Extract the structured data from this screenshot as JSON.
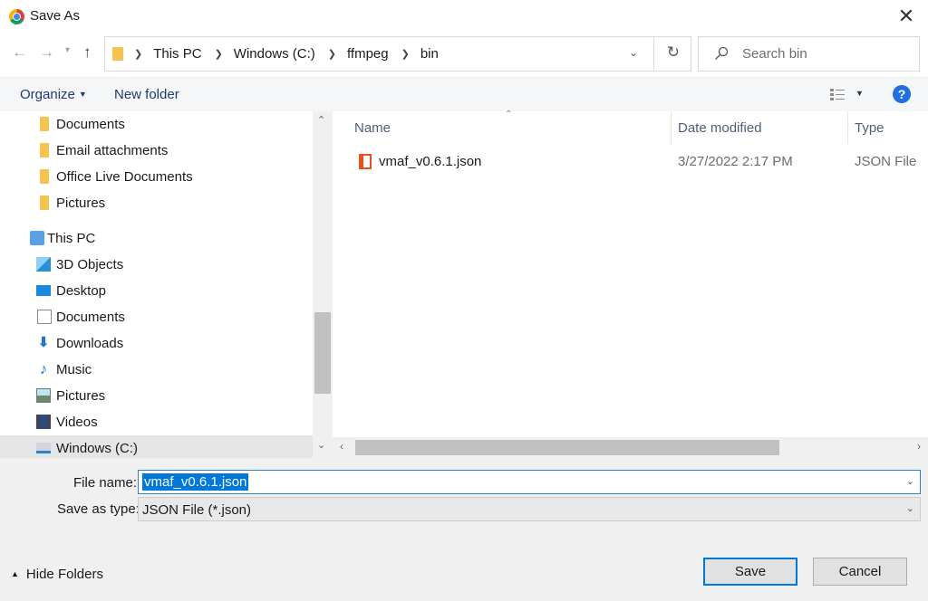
{
  "window": {
    "title": "Save As"
  },
  "address": {
    "crumbs": [
      "This PC",
      "Windows (C:)",
      "ffmpeg",
      "bin"
    ]
  },
  "search": {
    "placeholder": "Search bin"
  },
  "toolbar": {
    "organize": "Organize",
    "new_folder": "New folder",
    "help": "?"
  },
  "nav": {
    "items": [
      {
        "label": "Documents",
        "icon": "folder-icon"
      },
      {
        "label": "Email attachments",
        "icon": "folder-icon"
      },
      {
        "label": "Office Live Documents",
        "icon": "folder-icon"
      },
      {
        "label": "Pictures",
        "icon": "folder-icon"
      },
      {
        "label": "This PC",
        "icon": "computer-icon"
      },
      {
        "label": "3D Objects",
        "icon": "3d-objects-icon"
      },
      {
        "label": "Desktop",
        "icon": "desktop-icon"
      },
      {
        "label": "Documents",
        "icon": "documents-icon"
      },
      {
        "label": "Downloads",
        "icon": "downloads-icon"
      },
      {
        "label": "Music",
        "icon": "music-icon"
      },
      {
        "label": "Pictures",
        "icon": "pictures-icon"
      },
      {
        "label": "Videos",
        "icon": "videos-icon"
      },
      {
        "label": "Windows (C:)",
        "icon": "drive-icon"
      }
    ],
    "selected": "Windows (C:)"
  },
  "filelist": {
    "columns": [
      "Name",
      "Date modified",
      "Type"
    ],
    "rows": [
      {
        "name": "vmaf_v0.6.1.json",
        "date": "3/27/2022 2:17 PM",
        "type": "JSON File"
      }
    ]
  },
  "form": {
    "file_name_label": "File name:",
    "file_name_value": "vmaf_v0.6.1.json",
    "type_label": "Save as type:",
    "type_value": "JSON File (*.json)"
  },
  "footer": {
    "hide_folders": "Hide Folders",
    "save": "Save",
    "cancel": "Cancel"
  },
  "colors": {
    "accent": "#0078d7",
    "office_icon": "#e3521f",
    "folder": "#f4c451"
  }
}
